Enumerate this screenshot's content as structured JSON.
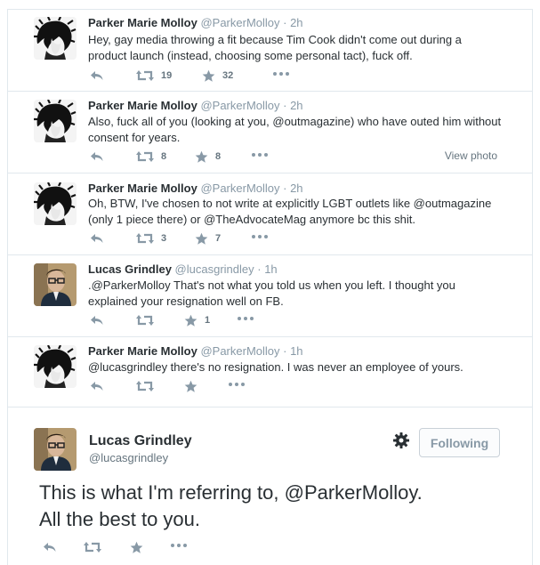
{
  "tweets": [
    {
      "author": "Parker Marie Molloy",
      "handle": "@ParkerMolloy",
      "time": "2h",
      "lines": [
        "Hey, gay media throwing a fit because Tim Cook didn't come out during a",
        "product launch (instead, choosing some personal tact), fuck off."
      ],
      "retweets": "19",
      "favorites": "32",
      "avatar": "parker"
    },
    {
      "author": "Parker Marie Molloy",
      "handle": "@ParkerMolloy",
      "time": "2h",
      "lines": [
        "Also, fuck all of you (looking at you, @outmagazine) who have outed him without",
        "consent for years."
      ],
      "retweets": "8",
      "favorites": "8",
      "view_photo": "View photo",
      "avatar": "parker"
    },
    {
      "author": "Parker Marie Molloy",
      "handle": "@ParkerMolloy",
      "time": "2h",
      "lines": [
        "Oh, BTW, I've chosen to not write at explicitly LGBT outlets like @outmagazine",
        "(only 1 piece there) or @TheAdvocateMag anymore bc this shit."
      ],
      "retweets": "3",
      "favorites": "7",
      "avatar": "parker"
    },
    {
      "author": "Lucas Grindley",
      "handle": "@lucasgrindley",
      "time": "1h",
      "lines": [
        ".@ParkerMolloy That's not what you told us when you left. I thought you",
        "explained your resignation well on FB."
      ],
      "retweets": "",
      "favorites": "1",
      "avatar": "lucas"
    },
    {
      "author": "Parker Marie Molloy",
      "handle": "@ParkerMolloy",
      "time": "1h",
      "lines": [
        "@lucasgrindley there's no resignation. I was never an employee of yours."
      ],
      "retweets": "",
      "favorites": "",
      "avatar": "parker"
    }
  ],
  "expanded": {
    "author": "Lucas Grindley",
    "handle": "@lucasgrindley",
    "follow_label": "Following",
    "lines": [
      "This is what I'm referring to, @ParkerMolloy.",
      "All the best to you."
    ]
  },
  "icons": {
    "reply": "reply-icon",
    "retweet": "retweet-icon",
    "favorite": "star-icon",
    "more": "more-dots-icon",
    "settings": "gear-icon"
  },
  "colors": {
    "text": "#292f33",
    "muted": "#8899a6",
    "border": "#e1e8ed"
  }
}
